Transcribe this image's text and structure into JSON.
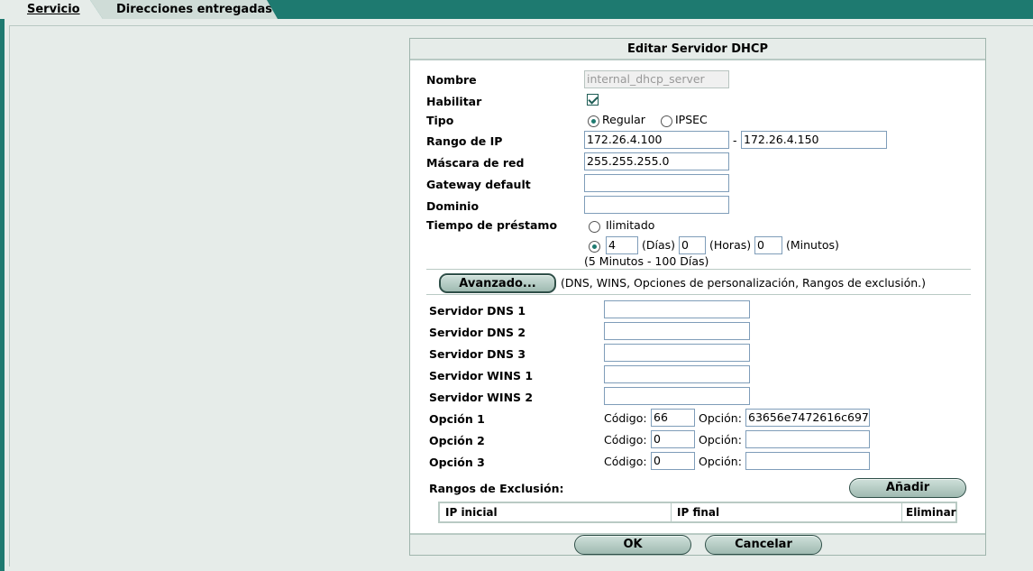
{
  "tabs": [
    {
      "label": "Servicio",
      "active": true
    },
    {
      "label": "Direcciones entregadas",
      "active": false
    }
  ],
  "form": {
    "title": "Editar Servidor DHCP",
    "labels": {
      "nombre": "Nombre",
      "habilitar": "Habilitar",
      "tipo": "Tipo",
      "rango_ip": "Rango de IP",
      "mascara": "Máscara de red",
      "gateway": "Gateway default",
      "dominio": "Dominio",
      "tiempo": "Tiempo de préstamo"
    },
    "nombre_value": "internal_dhcp_server",
    "habilitar_checked": true,
    "tipo_options": [
      "Regular",
      "IPSEC"
    ],
    "tipo_selected": "Regular",
    "range_separator": "-",
    "ip_start": "172.26.4.100",
    "ip_end": "172.26.4.150",
    "mascara_value": "255.255.255.0",
    "gateway_value": "",
    "dominio_value": "",
    "lease": {
      "unlimited_label": "Ilimitado",
      "days": "4",
      "days_label": "(Días)",
      "hours": "0",
      "hours_label": "(Horas)",
      "minutes": "0",
      "minutes_label": "(Minutos)",
      "range_hint": "(5 Minutos - 100 Días)"
    }
  },
  "advanced": {
    "button_label": "Avanzado...",
    "description": "(DNS, WINS, Opciones de personalización, Rangos de exclusión.)",
    "labels": {
      "dns1": "Servidor DNS 1",
      "dns2": "Servidor DNS 2",
      "dns3": "Servidor DNS 3",
      "wins1": "Servidor WINS 1",
      "wins2": "Servidor WINS 2"
    },
    "dns1": "",
    "dns2": "",
    "dns3": "",
    "wins1": "",
    "wins2": "",
    "code_label": "Código:",
    "option_label": "Opción:",
    "options": [
      {
        "label": "Opción 1",
        "code": "66",
        "value": "63656e7472616c697"
      },
      {
        "label": "Opción 2",
        "code": "0",
        "value": ""
      },
      {
        "label": "Opción 3",
        "code": "0",
        "value": ""
      }
    ],
    "exclusion_label": "Rangos de Exclusión:",
    "add_label": "Añadir",
    "table_headers": [
      "IP inicial",
      "IP final",
      "Eliminar"
    ]
  },
  "footer": {
    "ok": "OK",
    "cancel": "Cancelar"
  }
}
